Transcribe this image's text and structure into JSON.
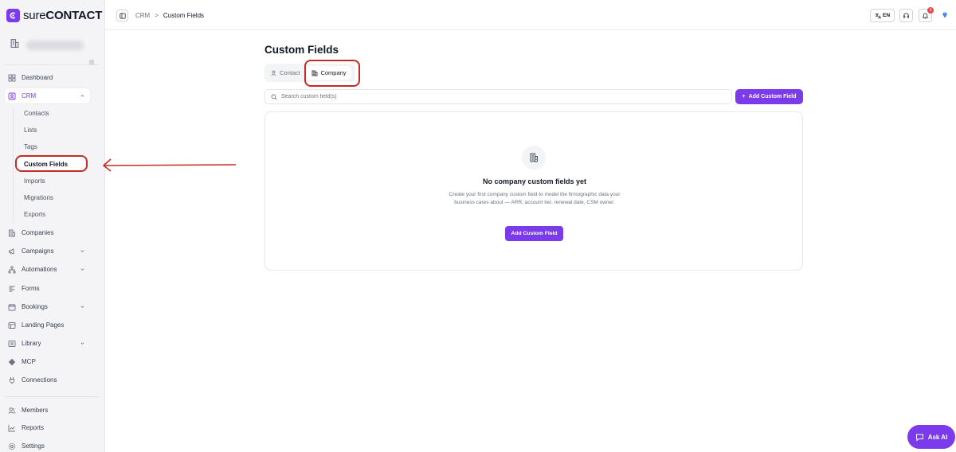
{
  "brand": {
    "name_prefix": "sure",
    "name_suffix": "CONTACT"
  },
  "sidebar": {
    "items": [
      {
        "label": "Dashboard"
      },
      {
        "label": "CRM"
      },
      {
        "label": "Companies"
      },
      {
        "label": "Campaigns"
      },
      {
        "label": "Automations"
      },
      {
        "label": "Forms"
      },
      {
        "label": "Bookings"
      },
      {
        "label": "Landing Pages"
      },
      {
        "label": "Library"
      },
      {
        "label": "MCP"
      },
      {
        "label": "Connections"
      },
      {
        "label": "Members"
      },
      {
        "label": "Reports"
      },
      {
        "label": "Settings"
      }
    ],
    "crm_sub": [
      {
        "label": "Contacts"
      },
      {
        "label": "Lists"
      },
      {
        "label": "Tags"
      },
      {
        "label": "Custom Fields"
      },
      {
        "label": "Imports"
      },
      {
        "label": "Migrations"
      },
      {
        "label": "Exports"
      }
    ]
  },
  "topbar": {
    "breadcrumb_root": "CRM",
    "breadcrumb_sep": ">",
    "breadcrumb_current": "Custom Fields",
    "language": "EN",
    "notification_count": "5"
  },
  "page": {
    "title": "Custom Fields",
    "tabs": [
      {
        "label": "Contact"
      },
      {
        "label": "Company"
      }
    ],
    "search_placeholder": "Search custom field(s)",
    "add_button": "Add Custom Field",
    "add_button_icon": "+"
  },
  "empty_state": {
    "title": "No company custom fields yet",
    "description": "Create your first company custom field to model the firmographic data your business cares about — ARR, account tier, renewal date, CSM owner.",
    "button": "Add Custom Field"
  },
  "ask_ai": {
    "label": "Ask AI"
  },
  "colors": {
    "accent": "#7c3aed",
    "annotation": "#c42b24"
  }
}
